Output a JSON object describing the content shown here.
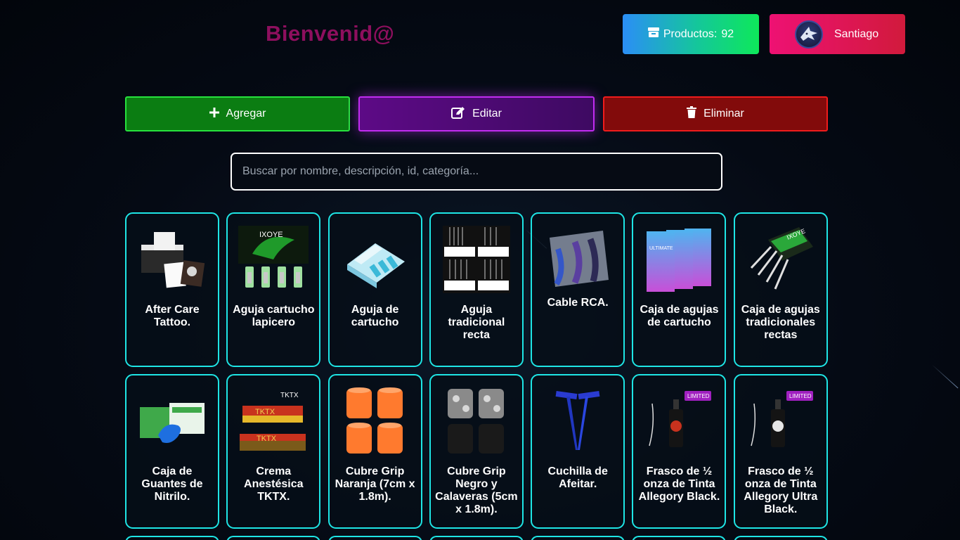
{
  "header": {
    "title": "Bienvenid@",
    "products_label": "Productos:",
    "products_count": "92",
    "products_icon": "box-icon",
    "user_name": "Santiago"
  },
  "actions": {
    "add_label": "Agregar",
    "edit_label": "Editar",
    "delete_label": "Eliminar"
  },
  "search": {
    "placeholder": "Buscar por nombre, descripción, id, categoría...",
    "value": ""
  },
  "colors": {
    "background": "#03070f",
    "title": "#8e0f5e",
    "card_border": "#1ee5e5",
    "add": "#0b7d12",
    "edit": "#5d0a86",
    "delete": "#820b0b"
  },
  "products": [
    {
      "name": "After Care Tattoo.",
      "icon": "aftercare-box-image"
    },
    {
      "name": "Aguja cartucho lapicero",
      "icon": "cartridge-needle-image"
    },
    {
      "name": "Aguja de cartucho",
      "icon": "cartridge-pack-image"
    },
    {
      "name": "Aguja tradicional recta",
      "icon": "traditional-needle-image"
    },
    {
      "name": "Cable RCA.",
      "icon": "rca-cable-image"
    },
    {
      "name": "Caja de agujas de cartucho",
      "icon": "cartridge-box-image"
    },
    {
      "name": "Caja de agujas tradicionales rectas",
      "icon": "needle-box-image"
    },
    {
      "name": "Caja de Guantes de Nitrilo.",
      "icon": "gloves-box-image"
    },
    {
      "name": "Crema Anestésica TKTX.",
      "icon": "tktx-cream-image"
    },
    {
      "name": "Cubre Grip Naranja (7cm x 1.8m).",
      "icon": "orange-grip-image"
    },
    {
      "name": "Cubre Grip Negro y Calaveras (5cm x 1.8m).",
      "icon": "skull-grip-image"
    },
    {
      "name": "Cuchilla de Afeitar.",
      "icon": "razor-image"
    },
    {
      "name": "Frasco de ½ onza de Tinta Allegory Black.",
      "icon": "ink-bottle-image"
    },
    {
      "name": "Frasco de ½ onza de Tinta Allegory Ultra Black.",
      "icon": "ink-bottle-image"
    }
  ]
}
